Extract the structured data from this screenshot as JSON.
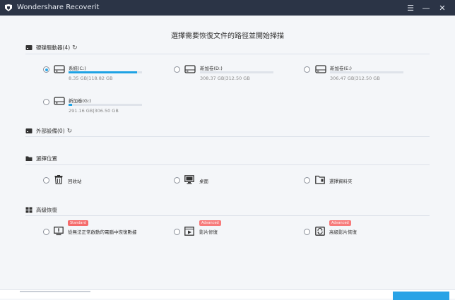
{
  "app": {
    "title": "Wondershare Recoverit"
  },
  "titlebar": {
    "menu_icon": "☰",
    "min_icon": "—",
    "close_icon": "✕"
  },
  "page_title": "選擇需要恢復文件的路徑並開始掃描",
  "sections": {
    "hard_drives": {
      "label": "硬碟驅動器(4)"
    },
    "external": {
      "label": "外部設備(0)"
    },
    "location": {
      "label": "選擇位置"
    },
    "advanced": {
      "label": "高級恢復"
    }
  },
  "drives": [
    {
      "name": "系統(C:)",
      "size": "8.35 GB|118.82 GB",
      "used": 0.93,
      "selected": true
    },
    {
      "name": "新加卷(D:)",
      "size": "308.37 GB|312.50 GB",
      "used": 0.0,
      "selected": false
    },
    {
      "name": "新加卷(E:)",
      "size": "306.47 GB|312.50 GB",
      "used": 0.0,
      "selected": false
    },
    {
      "name": "新加卷(G:)",
      "size": "291.16 GB|306.50 GB",
      "used": 0.05,
      "selected": false
    }
  ],
  "locations": [
    {
      "label": "回收站",
      "icon": "trash-icon"
    },
    {
      "label": "桌面",
      "icon": "monitor-icon"
    },
    {
      "label": "選擇資料夾",
      "icon": "folder-icon"
    }
  ],
  "advanced": [
    {
      "label": "從無法正常啟動的電腦中恢復數據",
      "badge": "Standard",
      "icon": "alert-monitor-icon"
    },
    {
      "label": "影片修復",
      "badge": "Advanced",
      "icon": "video-icon"
    },
    {
      "label": "高級影片恢復",
      "badge": "Advanced",
      "icon": "video-recover-icon"
    }
  ],
  "colors": {
    "accent": "#1ea2e4",
    "titlebar": "#2b3446",
    "badge": "#f56b6b"
  }
}
